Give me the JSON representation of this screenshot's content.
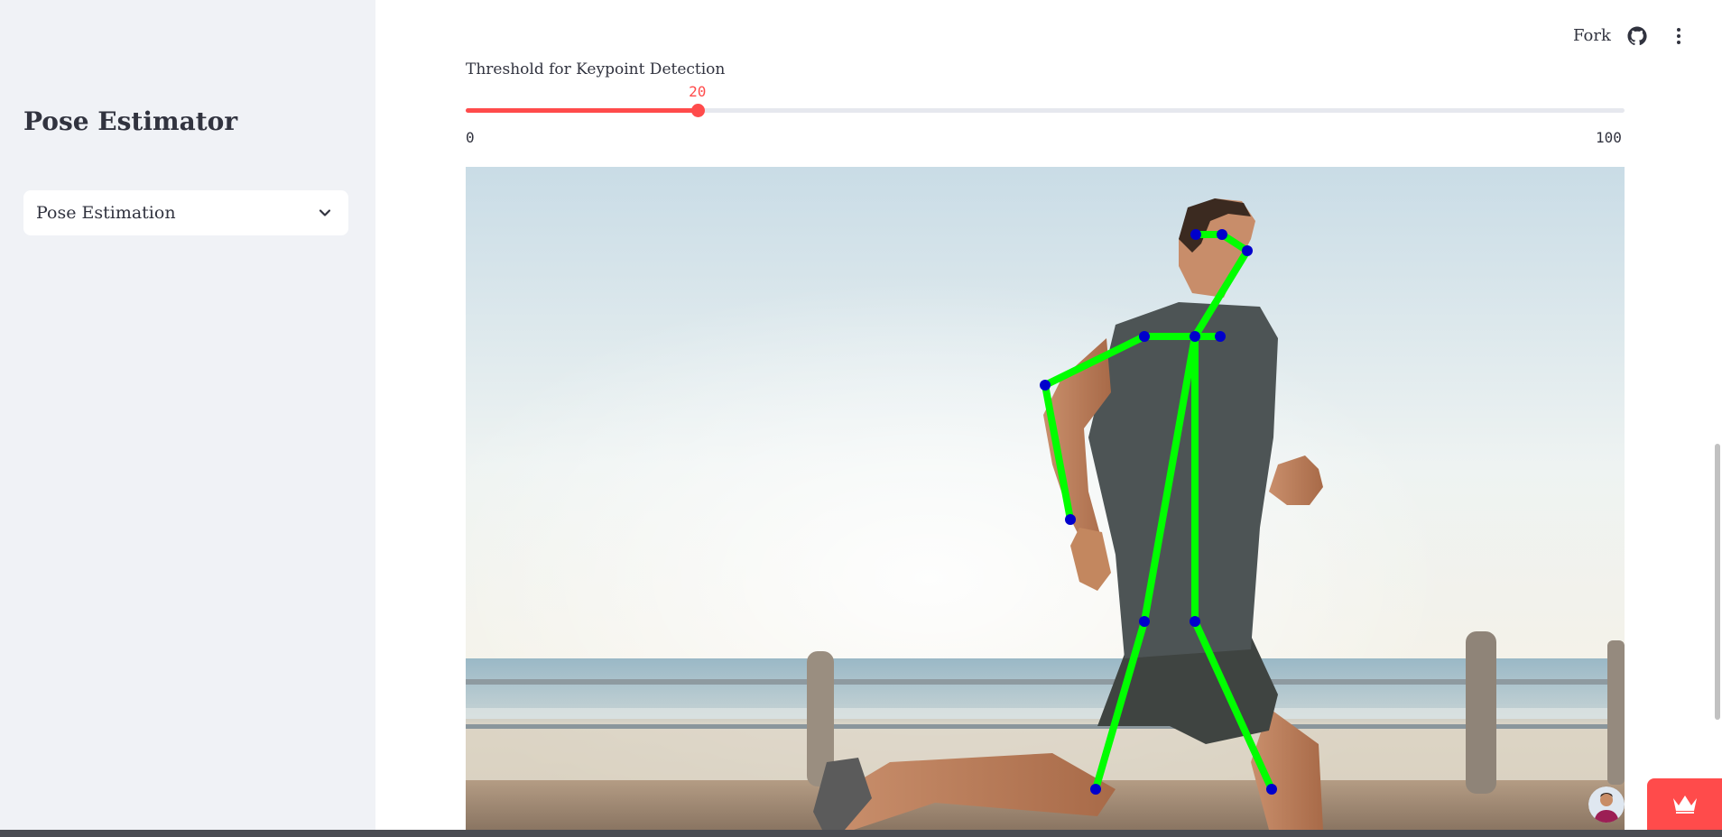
{
  "sidebar": {
    "title": "Pose Estimator",
    "select": {
      "value": "Pose Estimation"
    },
    "background": "#f0f2f6"
  },
  "header": {
    "fork_label": "Fork",
    "icons": [
      "github-icon",
      "more-vertical-icon"
    ]
  },
  "slider": {
    "label": "Threshold for Keypoint Detection",
    "value": "20",
    "min": "0",
    "max": "100",
    "accent": "#ff4b4b"
  },
  "image": {
    "description_icon": "photo-of-runner-with-pose-skeleton",
    "skeleton_color": "#00ff00",
    "keypoint_color": "#0000cc"
  },
  "floating": {
    "icons": [
      "avatar",
      "crown-icon"
    ],
    "crown_bg": "#ff4b4b"
  }
}
